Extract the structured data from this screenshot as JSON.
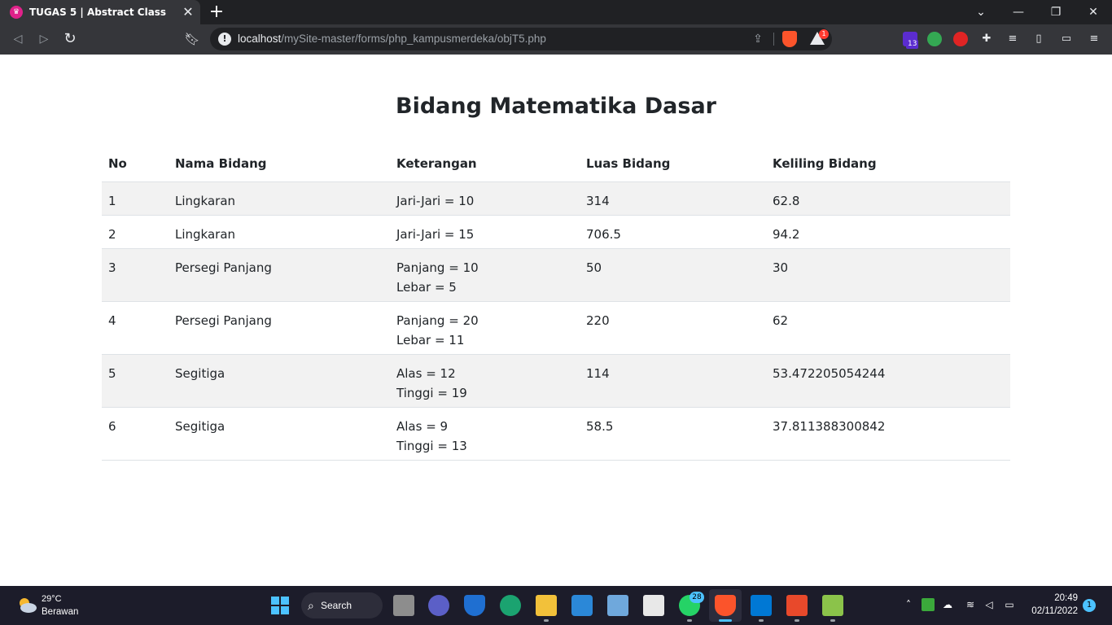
{
  "browser": {
    "tab": {
      "title": "TUGAS 5 | Abstract Class"
    },
    "url": {
      "host": "localhost",
      "path": "/mySite-master/forms/php_kampusmerdeka/objT5.php"
    },
    "rewards_badge": "1",
    "extension_badge": "13"
  },
  "page": {
    "title": "Bidang Matematika Dasar",
    "table": {
      "headers": [
        "No",
        "Nama Bidang",
        "Keterangan",
        "Luas Bidang",
        "Keliling Bidang"
      ],
      "rows": [
        {
          "no": "1",
          "nama": "Lingkaran",
          "ket1": "Jari-Jari = 10",
          "ket2": "",
          "luas": "314",
          "keliling": "62.8"
        },
        {
          "no": "2",
          "nama": "Lingkaran",
          "ket1": "Jari-Jari = 15",
          "ket2": "",
          "luas": "706.5",
          "keliling": "94.2"
        },
        {
          "no": "3",
          "nama": "Persegi Panjang",
          "ket1": "Panjang = 10",
          "ket2": "Lebar = 5",
          "luas": "50",
          "keliling": "30"
        },
        {
          "no": "4",
          "nama": "Persegi Panjang",
          "ket1": "Panjang = 20",
          "ket2": "Lebar = 11",
          "luas": "220",
          "keliling": "62"
        },
        {
          "no": "5",
          "nama": "Segitiga",
          "ket1": "Alas = 12",
          "ket2": "Tinggi = 19",
          "luas": "114",
          "keliling": "53.472205054244"
        },
        {
          "no": "6",
          "nama": "Segitiga",
          "ket1": "Alas = 9",
          "ket2": "Tinggi = 13",
          "luas": "58.5",
          "keliling": "37.811388300842"
        }
      ]
    }
  },
  "taskbar": {
    "weather": {
      "temp": "29°C",
      "desc": "Berawan"
    },
    "search_label": "Search",
    "whatsapp_badge": "28",
    "clock": {
      "time": "20:49",
      "date": "02/11/2022"
    },
    "notification_count": "1"
  }
}
